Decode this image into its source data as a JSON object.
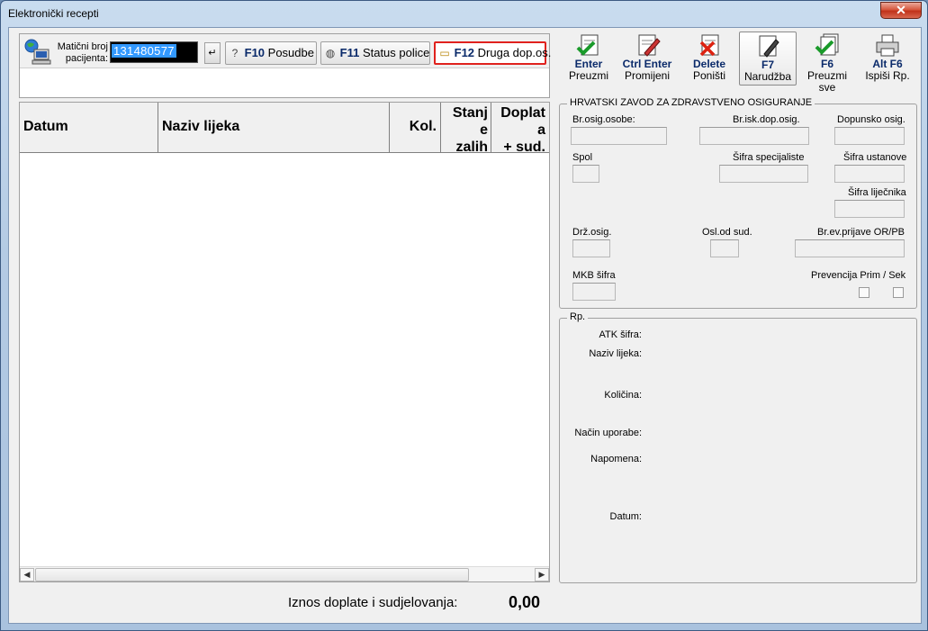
{
  "window": {
    "title": "Elektronički recepti",
    "close": "✕"
  },
  "patient": {
    "label_line1": "Matični broj",
    "label_line2": "pacijenta:",
    "id_value": "131480577"
  },
  "toolbar_left": {
    "f10_key": "F10",
    "f10_label": "Posudbe",
    "f11_key": "F11",
    "f11_label": "Status police",
    "f12_key": "F12",
    "f12_label": "Druga dop.os."
  },
  "toolbar_right": [
    {
      "key": "Enter",
      "label": "Preuzmi"
    },
    {
      "key": "Ctrl Enter",
      "label": "Promijeni"
    },
    {
      "key": "Delete",
      "label": "Poništi"
    },
    {
      "key": "F7",
      "label": "Narudžba"
    },
    {
      "key": "F6",
      "label": "Preuzmi sve"
    },
    {
      "key": "Alt F6",
      "label": "Ispiši Rp."
    }
  ],
  "grid": {
    "columns": {
      "datum": "Datum",
      "naziv": "Naziv lijeka",
      "kol": "Kol.",
      "stanje_1": "Stanj",
      "stanje_2": "e",
      "stanje_3": "zalih",
      "doplata_1": "Doplat",
      "doplata_2": "a",
      "doplata_3": "+ sud."
    },
    "rows": []
  },
  "total": {
    "label": "Iznos doplate i sudjelovanja:",
    "value": "0,00"
  },
  "hzzo": {
    "title": "HRVATSKI ZAVOD ZA ZDRAVSTVENO OSIGURANJE",
    "br_osig_osobe": "Br.osig.osobe:",
    "br_isk_dop_osig": "Br.isk.dop.osig.",
    "dopunsko_osig": "Dopunsko osig.",
    "spol": "Spol",
    "sifra_specijaliste": "Šifra specijaliste",
    "sifra_ustanove": "Šifra ustanove",
    "sifra_lijecnika": "Šifra liječnika",
    "drz_osig": "Drž.osig.",
    "osl_od_sud": "Osl.od sud.",
    "br_ev_prijave": "Br.ev.prijave OR/PB",
    "mkb_sifra": "MKB šifra",
    "prevencija": "Prevencija Prim / Sek"
  },
  "rp": {
    "title": "Rp.",
    "atk": "ATK šifra:",
    "naziv": "Naziv lijeka:",
    "kolicina": "Količina:",
    "nacin": "Način uporabe:",
    "napomena": "Napomena:",
    "datum": "Datum:"
  }
}
